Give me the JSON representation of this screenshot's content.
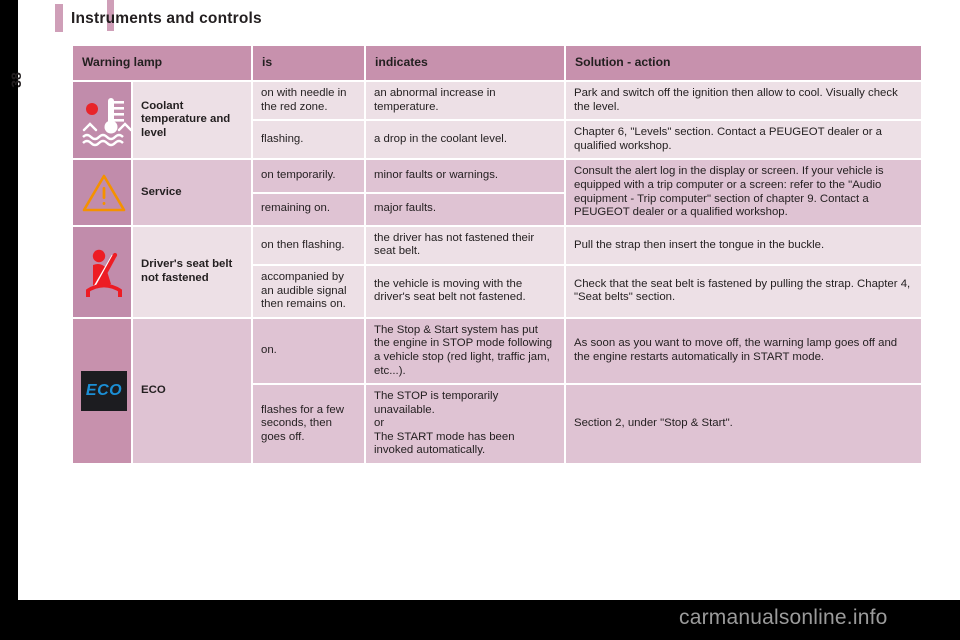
{
  "page": {
    "title": "Instruments and controls",
    "number": "38",
    "watermark": "carmanualsonline.info",
    "accent_color": "#cf9fb8",
    "header_row_color": "#c791ad",
    "light_row_color": "#ede0e6",
    "mid_row_color": "#dfc3d3"
  },
  "table": {
    "headers": {
      "lamp": "Warning lamp",
      "is": "is",
      "indicates": "indicates",
      "solution": "Solution - action"
    },
    "rows": [
      {
        "icon": "coolant-temperature-icon",
        "name": "Coolant temperature and level",
        "entries": [
          {
            "is": "on with needle in the red zone.",
            "indicates": "an abnormal increase in temperature.",
            "solution": "Park and switch off the ignition then allow to cool. Visually check the level."
          },
          {
            "is": "flashing.",
            "indicates": "a drop in the coolant level.",
            "solution": "Chapter 6, \"Levels\" section. Contact a PEUGEOT dealer or a qualified workshop."
          }
        ]
      },
      {
        "icon": "service-warning-triangle-icon",
        "name": "Service",
        "entries": [
          {
            "is": "on temporarily.",
            "indicates": "minor faults or warnings.",
            "solution": "Consult the alert log in the display or screen. If your vehicle is equipped with a trip computer or a screen: refer to the \"Audio equipment - Trip computer\" section of chapter 9. Contact a PEUGEOT dealer or a qualified workshop."
          },
          {
            "is": "remaining on.",
            "indicates": "major faults.",
            "solution": ""
          }
        ]
      },
      {
        "icon": "seat-belt-not-fastened-icon",
        "name": "Driver's seat belt not fastened",
        "entries": [
          {
            "is": "on then flashing.",
            "indicates": "the driver has not fastened their seat belt.",
            "solution": "Pull the strap then insert the tongue in the buckle."
          },
          {
            "is": "accompanied by an audible signal then remains on.",
            "indicates": "the vehicle is moving with the driver's seat belt not fastened.",
            "solution": "Check that the seat belt is fastened by pulling the strap. Chapter 4, \"Seat belts\" section."
          }
        ]
      },
      {
        "icon": "eco-badge-icon",
        "icon_label": "ECO",
        "name": "ECO",
        "entries": [
          {
            "is": "on.",
            "indicates": "The Stop & Start system has put the engine in STOP mode following a vehicle stop (red light, traffic jam, etc...).",
            "solution": "As soon as you want to move off, the warning lamp goes off and the engine restarts automatically in START mode."
          },
          {
            "is": "flashes for a few seconds, then goes off.",
            "indicates": "The STOP is temporarily unavailable.\nor\nThe START mode has been invoked automatically.",
            "solution": "Section 2, under \"Stop & Start\"."
          }
        ]
      }
    ]
  }
}
